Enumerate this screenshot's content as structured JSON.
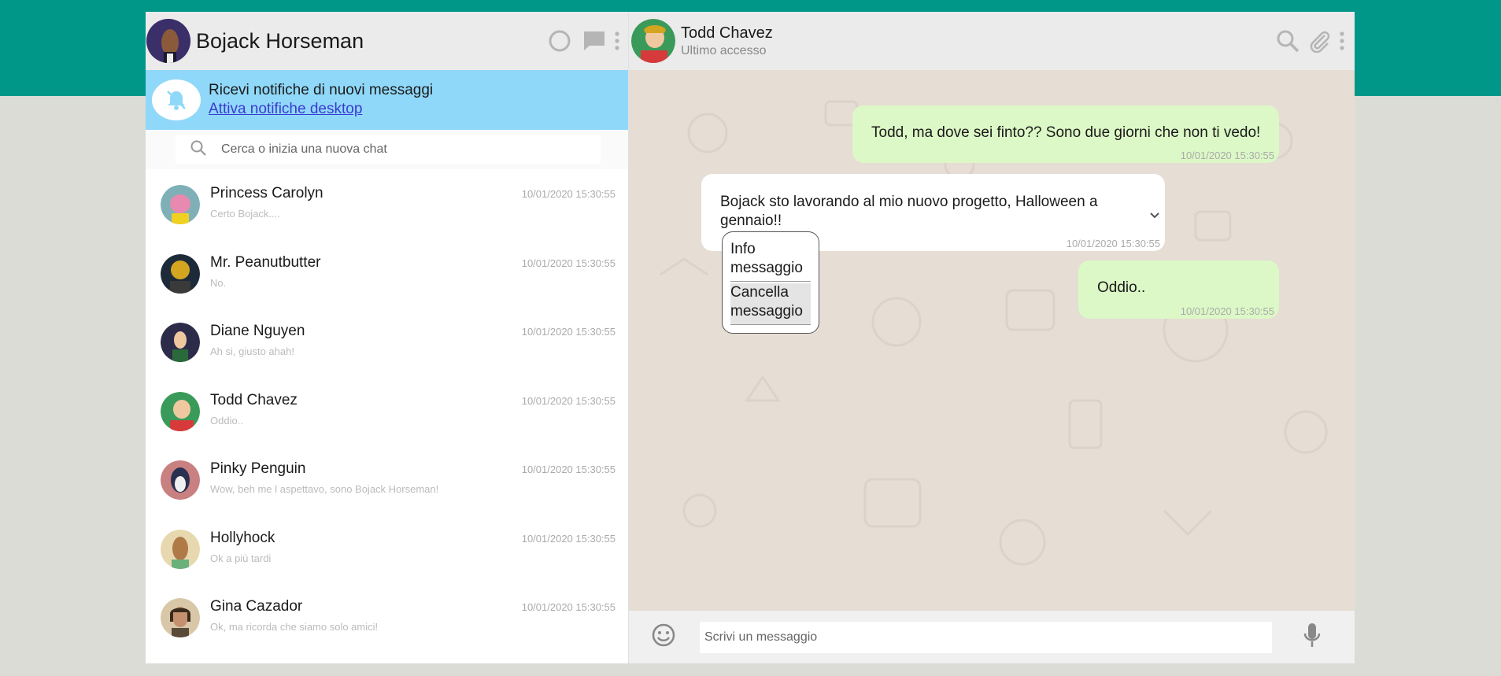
{
  "colors": {
    "brand": "#009688",
    "notify_bg": "#90d8f9",
    "sent_bubble": "#dcf8c6",
    "chat_bg": "#e6ddd4"
  },
  "me": {
    "name": "Bojack Horseman"
  },
  "header_icons": [
    "status-icon",
    "new-chat-icon",
    "menu-icon"
  ],
  "notification": {
    "title": "Ricevi notifiche di nuovi messaggi",
    "link": "Attiva notifiche desktop"
  },
  "search": {
    "placeholder": "Cerca o inizia una nuova chat"
  },
  "chats": [
    {
      "name": "Princess Carolyn",
      "time": "10/01/2020 15:30:55",
      "preview": "Certo Bojack....",
      "color": "#e88ab0"
    },
    {
      "name": "Mr. Peanutbutter",
      "time": "10/01/2020 15:30:55",
      "preview": "No.",
      "color": "#d4a520"
    },
    {
      "name": "Diane Nguyen",
      "time": "10/01/2020 15:30:55",
      "preview": "Ah si, giusto ahah!",
      "color": "#2c2c4a"
    },
    {
      "name": "Todd Chavez",
      "time": "10/01/2020 15:30:55",
      "preview": "Oddio..",
      "color": "#d63a3a"
    },
    {
      "name": "Pinky Penguin",
      "time": "10/01/2020 15:30:55",
      "preview": "Wow, beh me l aspettavo, sono Bojack Horseman!",
      "color": "#c88080"
    },
    {
      "name": "Hollyhock",
      "time": "10/01/2020 15:30:55",
      "preview": "Ok a più tardi",
      "color": "#c89060"
    },
    {
      "name": "Gina Cazador",
      "time": "10/01/2020 15:30:55",
      "preview": "Ok, ma ricorda che siamo solo amici!",
      "color": "#8a6a4a"
    }
  ],
  "contact": {
    "name": "Todd Chavez",
    "status": "Ultimo accesso"
  },
  "messages": [
    {
      "type": "sent",
      "text": "Todd, ma dove sei finto?? Sono due giorni che non ti vedo!",
      "time": "10/01/2020 15:30:55"
    },
    {
      "type": "received",
      "text": "Bojack sto lavorando al mio nuovo progetto, Halloween a gennaio!!",
      "time": "10/01/2020 15:30:55"
    },
    {
      "type": "sent",
      "text": "Oddio..",
      "time": "10/01/2020 15:30:55"
    }
  ],
  "message_menu": [
    "Info messaggio",
    "Cancella messaggio"
  ],
  "composer": {
    "placeholder": "Scrivi un messaggio"
  }
}
